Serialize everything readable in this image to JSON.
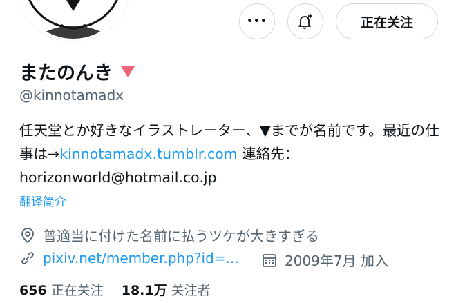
{
  "profile": {
    "display_name": "またのんき",
    "handle": "@kinnotamadx",
    "bio_text": "任天堂とか好きなイラストレーター、▼までが名前です。最近の仕事は→",
    "bio_link": "kinnotamadx.tumblr.com",
    "bio_contact": " 連絡先：horizonworld@hotmail.co.jp",
    "translate_label": "翻译简介",
    "location": "普適当に付けた名前に払うツケが大きすぎる",
    "website": "pixiv.net/member.php?id=...",
    "joined": "2009年7月 加入",
    "following_count": "656",
    "following_label": "正在关注",
    "followers_count": "18.1万",
    "followers_label": "关注者"
  },
  "actions": {
    "more_icon_text": "•••",
    "follow_label": "正在关注"
  },
  "colors": {
    "accent": "#1d9bf0",
    "name_triangle": "#f4637a",
    "muted": "#536471"
  },
  "icons": [
    "more-icon",
    "bell-plus-icon",
    "location-icon",
    "link-icon",
    "calendar-icon",
    "triangle-down-icon"
  ]
}
